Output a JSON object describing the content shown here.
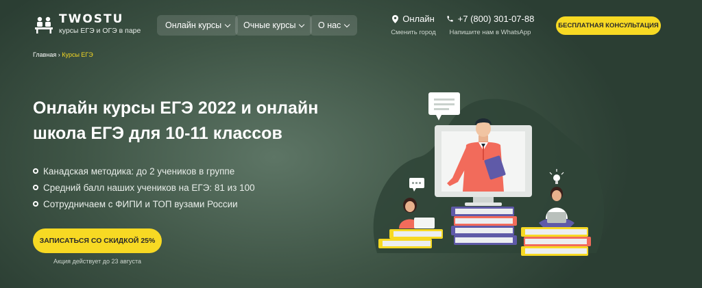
{
  "logo": {
    "name": "TWOSTU",
    "tagline": "курсы ЕГЭ и ОГЭ в паре"
  },
  "nav": [
    {
      "label": "Онлайн курсы"
    },
    {
      "label": "Очные курсы"
    },
    {
      "label": "О нас"
    }
  ],
  "location": {
    "label": "Онлайн",
    "sub": "Сменить город"
  },
  "phone": {
    "number": "+7 (800) 301-07-88",
    "sub": "Напишите нам в WhatsApp"
  },
  "consult_button": "БЕСПЛАТНАЯ КОНСУЛЬТАЦИЯ",
  "breadcrumb": {
    "home": "Главная",
    "separator": "›",
    "current": "Курсы ЕГЭ"
  },
  "hero": {
    "title": "Онлайн курсы ЕГЭ 2022 и онлайн школа ЕГЭ для 10-11 классов",
    "features": [
      "Канадская методика: до 2 учеников в группе",
      "Средний балл наших учеников на ЕГЭ: 81 из 100",
      "Сотрудничаем с ФИПИ и ТОП вузами России"
    ],
    "cta": "ЗАПИСАТЬСЯ СО СКИДКОЙ 25%",
    "promo_note": "Акция действует до 23 августа"
  },
  "colors": {
    "accent": "#f7d923",
    "background": "#3f5546",
    "suit": "#f26b5b",
    "book_purple": "#5f5aa8"
  },
  "icons": [
    "logo-desk-icon",
    "location-pin-icon",
    "phone-icon",
    "chevron-down-icon",
    "bullet-circle-icon"
  ]
}
